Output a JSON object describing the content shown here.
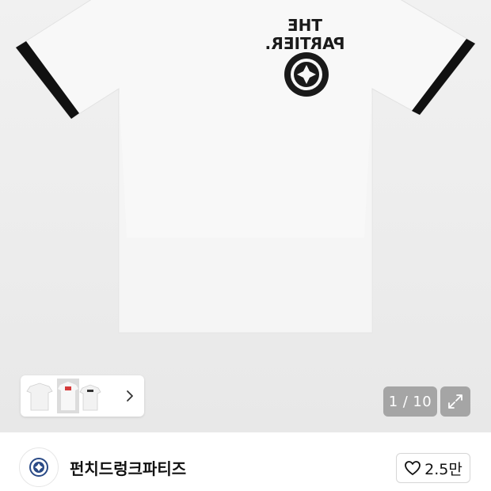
{
  "gallery": {
    "current_page": "1",
    "separator": "/",
    "total_pages": "10",
    "print_text": {
      "line1": "THE",
      "line2": "PARTIER."
    }
  },
  "seller": {
    "name": "펀치드렁크파티즈"
  },
  "like": {
    "count": "2.5만"
  },
  "icons": {
    "thumb_next": "chevron-right-icon",
    "expand": "expand-icon",
    "like": "heart-icon",
    "avatar": "logo-badge-icon"
  },
  "colors": {
    "tshirt": "#f7f7f7",
    "trim": "#111111",
    "background": "#ececec"
  }
}
